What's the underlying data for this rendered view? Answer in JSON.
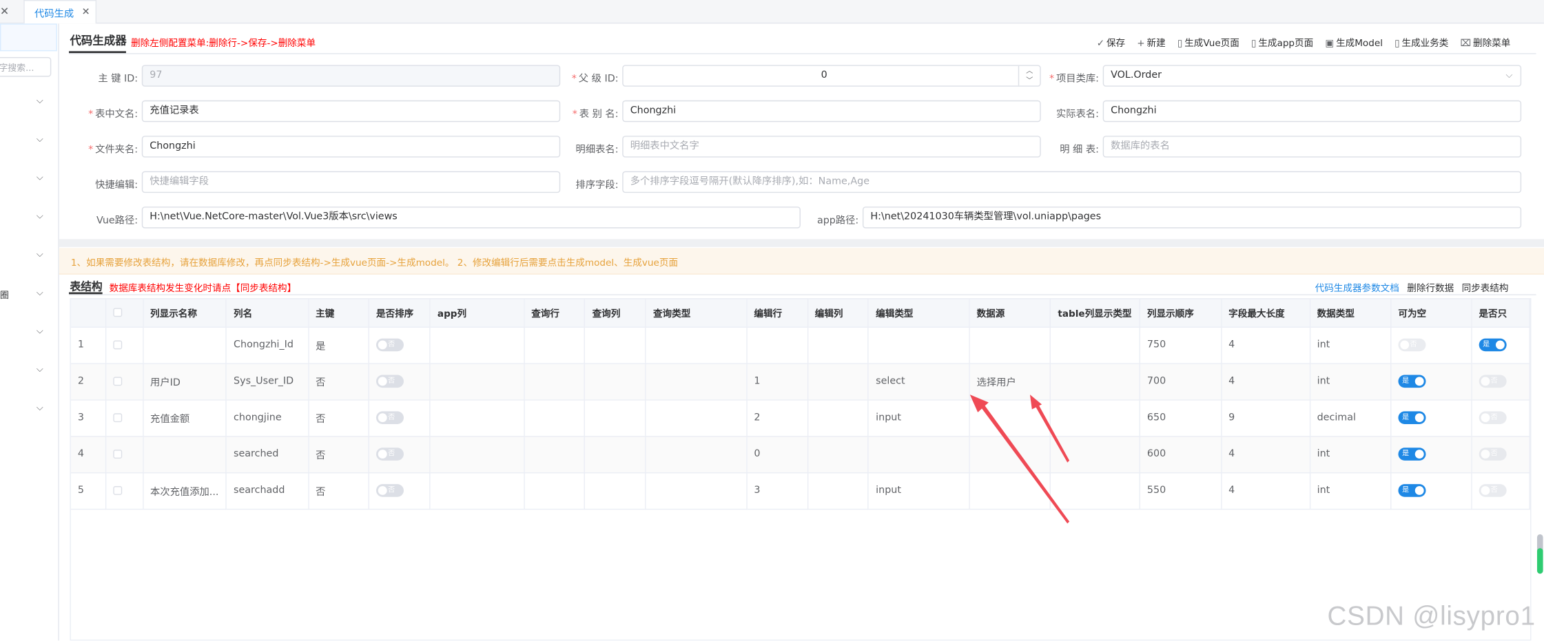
{
  "tabs": {
    "active_label": "代码生成"
  },
  "sidebar": {
    "search_placeholder": "字搜索...",
    "cut_label": "圈"
  },
  "header": {
    "title": "代码生成器",
    "hint": "删除左侧配置菜单:删除行->保存->删除菜单",
    "actions": [
      "保存",
      "新建",
      "生成Vue页面",
      "生成app页面",
      "生成Model",
      "生成业务类",
      "删除菜单"
    ]
  },
  "form": {
    "pk_id": {
      "label": "主 键 ID:",
      "value": "97"
    },
    "parent_id": {
      "label": "父 级 ID:",
      "value": "0"
    },
    "project_lib": {
      "label": "项目类库:",
      "value": "VOL.Order"
    },
    "table_cn": {
      "label": "表中文名:",
      "value": "充值记录表"
    },
    "table_alias": {
      "label": "表 别 名:",
      "value": "Chongzhi"
    },
    "table_real": {
      "label": "实际表名:",
      "value": "Chongzhi"
    },
    "folder": {
      "label": "文件夹名:",
      "value": "Chongzhi"
    },
    "detail_cn": {
      "label": "明细表名:",
      "placeholder": "明细表中文名字"
    },
    "detail_table": {
      "label": "明 细 表:",
      "placeholder": "数据库的表名"
    },
    "quick_edit": {
      "label": "快捷编辑:",
      "placeholder": "快捷编辑字段"
    },
    "sort_field": {
      "label": "排序字段:",
      "placeholder": "多个排序字段逗号隔开(默认降序排序),如：Name,Age"
    },
    "vue_path": {
      "label": "Vue路径:",
      "value": "H:\\net\\Vue.NetCore-master\\Vol.Vue3版本\\src\\views"
    },
    "app_path": {
      "label": "app路径:",
      "value": "H:\\net\\20241030车辆类型管理\\vol.uniapp\\pages"
    }
  },
  "notice": "1、如果需要修改表结构，请在数据库修改，再点同步表结构->生成vue页面->生成model。 2、修改编辑行后需要点击生成model、生成vue页面",
  "table_section": {
    "title": "表结构",
    "hint": "数据库表结构发生变化时请点【同步表结构】",
    "links": [
      "代码生成器参数文档",
      "删除行数据",
      "同步表结构"
    ]
  },
  "grid": {
    "columns": [
      "",
      "",
      "列显示名称",
      "列名",
      "主键",
      "是否排序",
      "app列",
      "查询行",
      "查询列",
      "查询类型",
      "编辑行",
      "编辑列",
      "编辑类型",
      "数据源",
      "table列显示类型",
      "列显示顺序",
      "字段最大长度",
      "数据类型",
      "可为空",
      "是否只"
    ],
    "switch_on": "是",
    "switch_off": "否",
    "rows": [
      {
        "no": "1",
        "display": "",
        "name": "Chongzhi_Id",
        "pk": "是",
        "edit_row": "",
        "edit_type": "",
        "source": "",
        "order": "750",
        "maxlen": "4",
        "dtype": "int",
        "nullable": false,
        "readonly": true
      },
      {
        "no": "2",
        "display": "用户ID",
        "name": "Sys_User_ID",
        "pk": "否",
        "edit_row": "1",
        "edit_type": "select",
        "source": "选择用户",
        "order": "700",
        "maxlen": "4",
        "dtype": "int",
        "nullable": true,
        "readonly": false
      },
      {
        "no": "3",
        "display": "充值金额",
        "name": "chongjine",
        "pk": "否",
        "edit_row": "2",
        "edit_type": "input",
        "source": "",
        "order": "650",
        "maxlen": "9",
        "dtype": "decimal",
        "nullable": true,
        "readonly": false
      },
      {
        "no": "4",
        "display": "",
        "name": "searched",
        "pk": "否",
        "edit_row": "0",
        "edit_type": "",
        "source": "",
        "order": "600",
        "maxlen": "4",
        "dtype": "int",
        "nullable": true,
        "readonly": false
      },
      {
        "no": "5",
        "display": "本次充值添加...",
        "name": "searchadd",
        "pk": "否",
        "edit_row": "3",
        "edit_type": "input",
        "source": "",
        "order": "550",
        "maxlen": "4",
        "dtype": "int",
        "nullable": true,
        "readonly": false
      }
    ]
  },
  "watermark": "CSDN @lisypro1",
  "colors": {
    "accent": "#1e88e5",
    "danger": "#ff0000",
    "warning": "#e6a23c",
    "arrow": "#ef4a55"
  }
}
